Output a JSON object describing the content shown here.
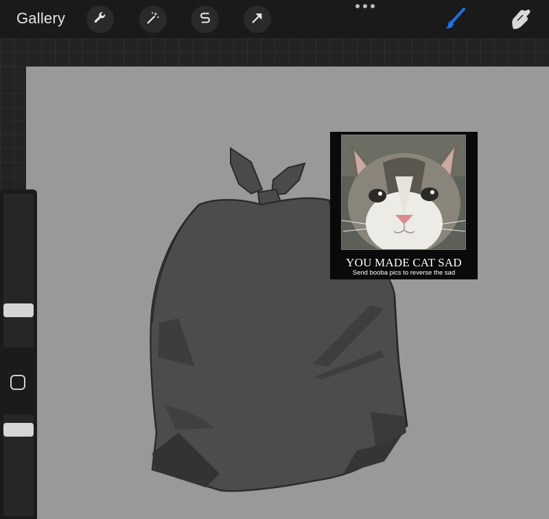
{
  "toolbar": {
    "gallery_label": "Gallery",
    "tools": [
      {
        "icon": "wrench-icon",
        "name": "actions"
      },
      {
        "icon": "magic-wand-icon",
        "name": "adjustments"
      },
      {
        "icon": "selection-s-icon",
        "name": "selection"
      },
      {
        "icon": "arrow-cursor-icon",
        "name": "transform"
      }
    ],
    "more_icon": "more-dots-icon",
    "brush_icon": "paintbrush-icon",
    "smudge_icon": "smudge-finger-icon",
    "accent_color": "#1e6fe0"
  },
  "canvas": {
    "background_color": "#999999",
    "meme": {
      "title": "YOU MADE CAT SAD",
      "subtitle": "Send booba pics to reverse the sad"
    }
  },
  "sidebar": {
    "brush_size_slider": "brush-size-slider",
    "opacity_slider": "opacity-slider",
    "modify_button": "modify-square-button"
  }
}
